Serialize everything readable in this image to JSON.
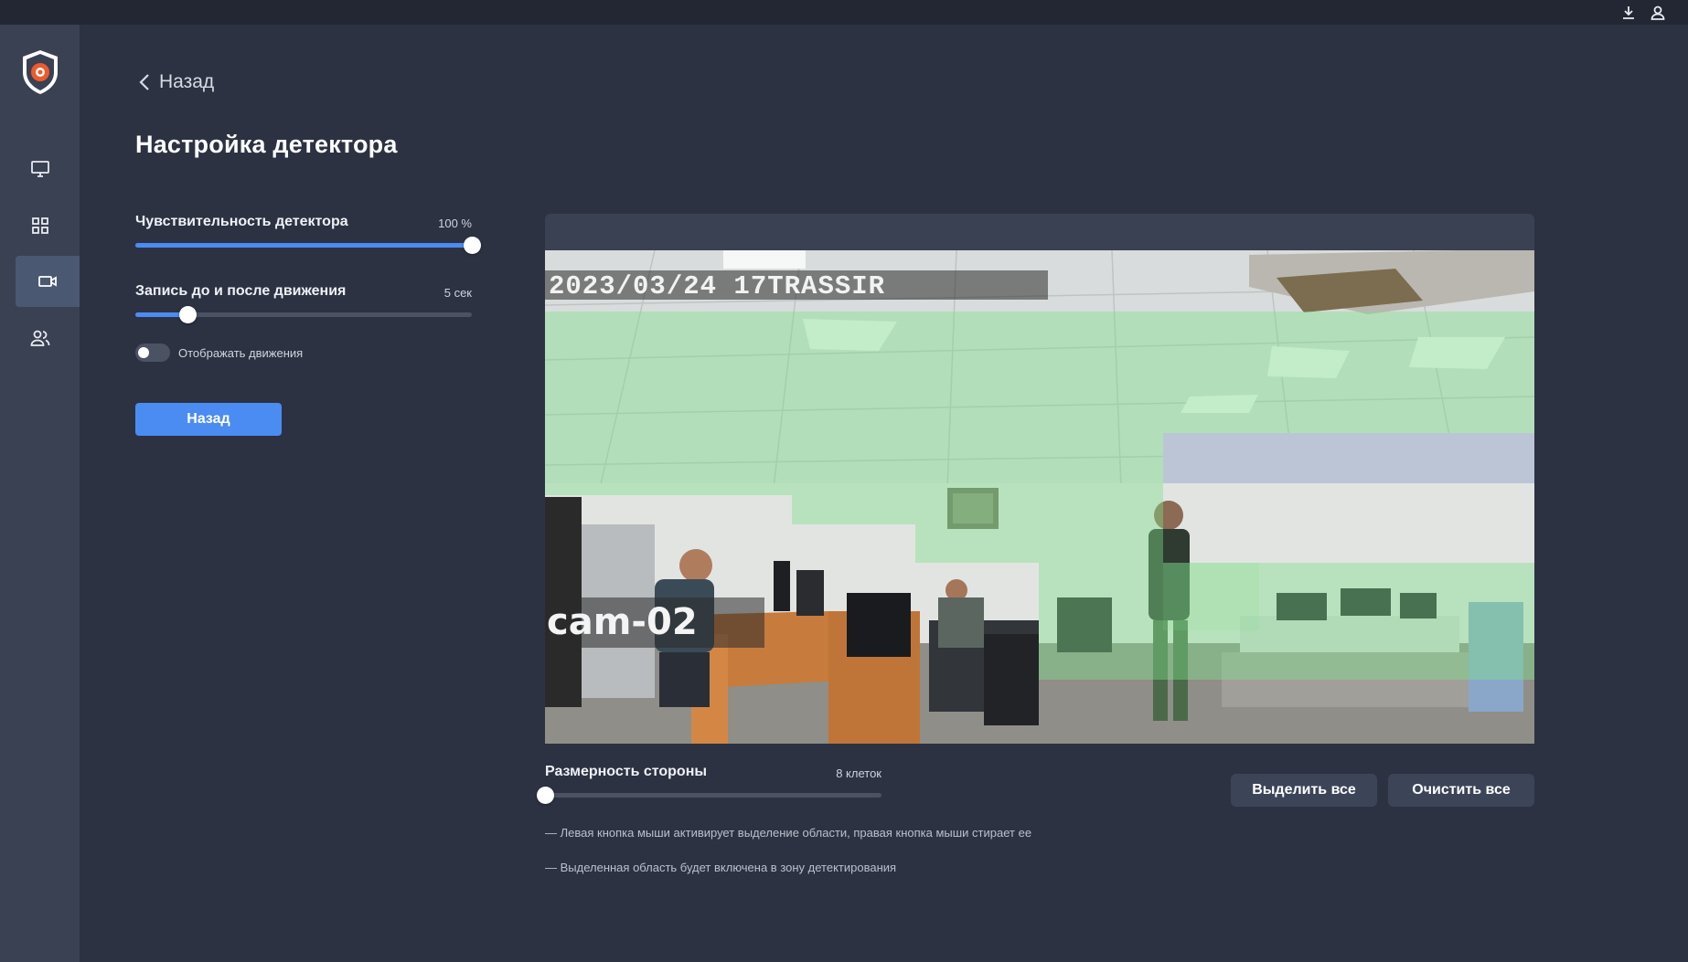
{
  "nav": {
    "back_label": "Назад",
    "items": [
      {
        "icon": "monitor-icon",
        "active": false
      },
      {
        "icon": "grid-icon",
        "active": false
      },
      {
        "icon": "camera-icon",
        "active": true
      },
      {
        "icon": "users-icon",
        "active": false
      }
    ]
  },
  "page": {
    "title": "Настройка детектора"
  },
  "settings": {
    "sensitivity": {
      "label": "Чувствительность детектора",
      "value_text": "100 %",
      "fraction": 1.0
    },
    "record": {
      "label": "Запись до и после движения",
      "value_text": "5 сек",
      "fraction": 0.155
    },
    "show_motion": {
      "label": "Отображать движения",
      "enabled": false
    },
    "back_button": "Назад"
  },
  "video": {
    "timestamp": "2023/03/24 17TRASSIR",
    "camera_name": "cam-02"
  },
  "grid": {
    "label": "Размерность стороны",
    "value_text": "8 клеток",
    "fraction": 0.0,
    "select_all": "Выделить все",
    "clear_all": "Очистить все"
  },
  "hints": [
    "— Левая кнопка мыши активирует выделение области, правая кнопка мыши стирает ее",
    "— Выделенная область будет включена в зону детектирования"
  ],
  "colors": {
    "accent": "#4b8cf2",
    "selection": "#7ee08a"
  }
}
